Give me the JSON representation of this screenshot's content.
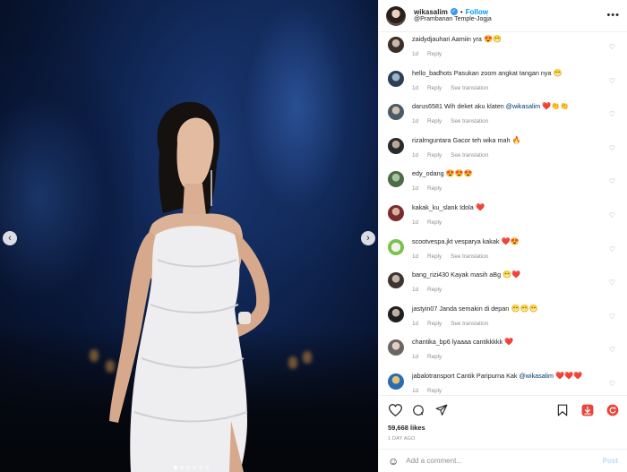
{
  "header": {
    "username": "wikasalim",
    "separator": "•",
    "follow_label": "Follow",
    "location": "@Prambanan Temple-Jogja",
    "more_icon": "more-horizontal-icon"
  },
  "comments": [
    {
      "user": "zaidydjauhari",
      "text": "Aamiin yra",
      "emoji": "😍😁",
      "time": "1d",
      "reply": "Reply",
      "translate": ""
    },
    {
      "user": "hello_badhots",
      "text": "Pasukan zoom angkat tangan nya",
      "emoji": "😁",
      "time": "1d",
      "reply": "Reply",
      "translate": "See translation"
    },
    {
      "user": "darus6581",
      "text": "Wih deket aku klaten",
      "mention": "@wikasalim",
      "emoji": "❤️👏👏",
      "time": "1d",
      "reply": "Reply",
      "translate": "See translation"
    },
    {
      "user": "rizalmguntara",
      "text": "Gacor teh wika mah",
      "emoji": "🔥",
      "time": "1d",
      "reply": "Reply",
      "translate": "See translation"
    },
    {
      "user": "edy_odang",
      "text": "",
      "emoji": "😍😍😍",
      "time": "1d",
      "reply": "Reply",
      "translate": ""
    },
    {
      "user": "kakak_ku_slank",
      "text": "Idola",
      "emoji": "❤️",
      "time": "1d",
      "reply": "Reply",
      "translate": ""
    },
    {
      "user": "scootvespa.jkt",
      "text": "vesparya kakak",
      "emoji": "❤️😍",
      "time": "1d",
      "reply": "Reply",
      "translate": "See translation"
    },
    {
      "user": "bang_rizi430",
      "text": "Kayak masih aBg",
      "emoji": "😁❤️",
      "time": "1d",
      "reply": "Reply",
      "translate": ""
    },
    {
      "user": "jastyin07",
      "text": "Janda semakin di depan",
      "emoji": "😁😁😁",
      "time": "1d",
      "reply": "Reply",
      "translate": "See translation"
    },
    {
      "user": "chantika_bp6",
      "text": "lyaaaa cantikkkkk",
      "emoji": "❤️",
      "time": "1d",
      "reply": "Reply",
      "translate": ""
    },
    {
      "user": "jabalotransport",
      "text": "Cantik Paripurna Kak",
      "mention": "@wikasalim",
      "emoji": "❤️❤️❤️",
      "time": "1d",
      "reply": "Reply",
      "translate": ""
    }
  ],
  "actions": {
    "like_icon": "heart-icon",
    "comment_icon": "comment-icon",
    "share_icon": "send-icon",
    "save_icon": "bookmark-icon",
    "download_icon": "download-icon",
    "extra_icon": "circular-arrow-icon"
  },
  "likes": "59,668 likes",
  "time_ago": "1 DAY AGO",
  "add_comment": {
    "placeholder": "Add a comment...",
    "post_label": "Post"
  },
  "carousel": {
    "prev_icon": "chevron-left-icon",
    "next_icon": "chevron-right-icon",
    "slide_count": 6,
    "active_slide": 1
  },
  "colors": {
    "accent": "#0095f6",
    "verified": "#3897f0",
    "heart_red": "#e0245e",
    "download_red": "#e8453c"
  }
}
